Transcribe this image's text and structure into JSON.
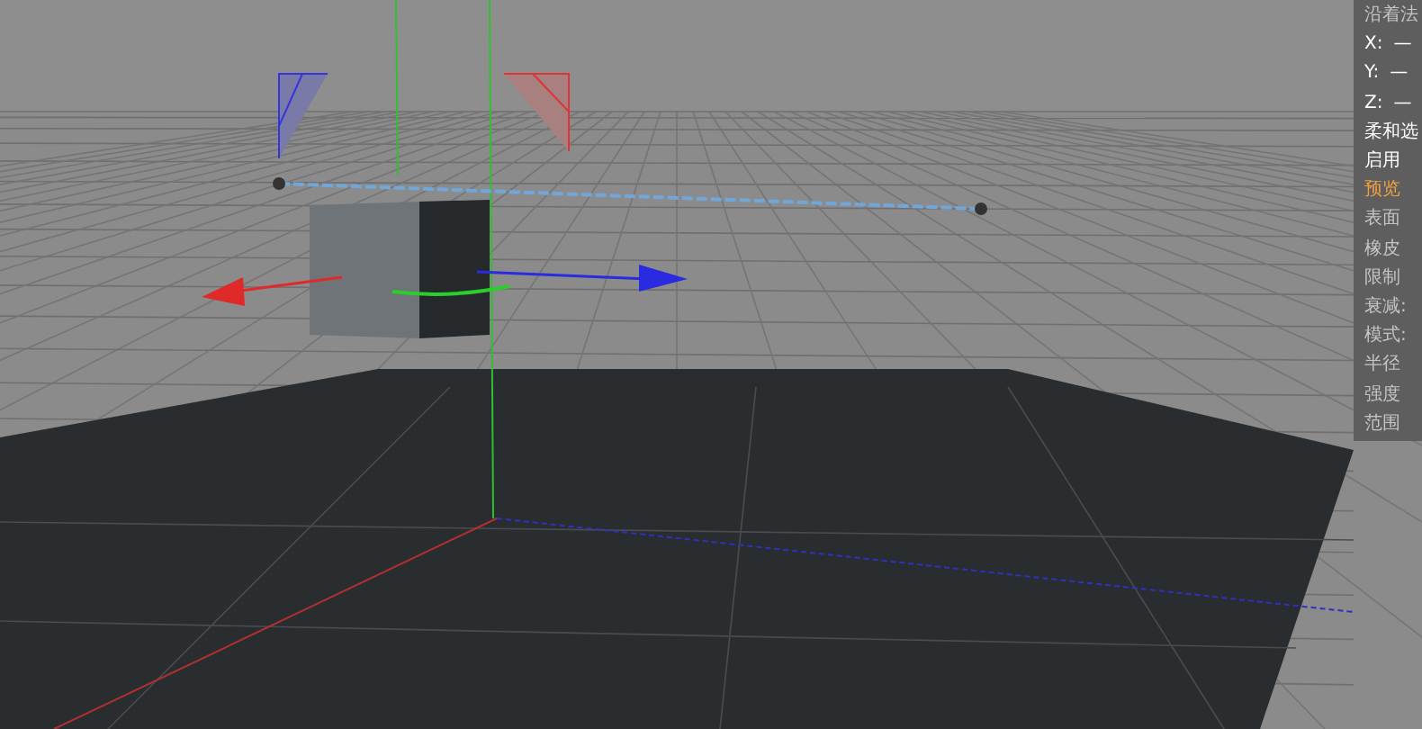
{
  "attribute_panel": {
    "items": [
      {
        "kind": "label",
        "text": "沿着法",
        "disabled": true,
        "highlighted": false
      },
      {
        "kind": "coord",
        "text": "X:",
        "value": "—",
        "disabled": false,
        "highlighted": false
      },
      {
        "kind": "coord",
        "text": "Y:",
        "value": "—",
        "disabled": false,
        "highlighted": false
      },
      {
        "kind": "coord",
        "text": "Z:",
        "value": "—",
        "disabled": false,
        "highlighted": false
      },
      {
        "kind": "label",
        "text": "柔和选",
        "disabled": false,
        "highlighted": false
      },
      {
        "kind": "label",
        "text": "启用",
        "disabled": false,
        "highlighted": false
      },
      {
        "kind": "label",
        "text": "预览",
        "disabled": false,
        "highlighted": true
      },
      {
        "kind": "label",
        "text": "表面",
        "disabled": true,
        "highlighted": false
      },
      {
        "kind": "label",
        "text": "橡皮",
        "disabled": true,
        "highlighted": false
      },
      {
        "kind": "label",
        "text": "限制",
        "disabled": true,
        "highlighted": false
      },
      {
        "kind": "label",
        "text": "衰减:",
        "disabled": true,
        "highlighted": false
      },
      {
        "kind": "label",
        "text": "模式:",
        "disabled": true,
        "highlighted": false
      },
      {
        "kind": "label",
        "text": "半径",
        "disabled": true,
        "highlighted": false
      },
      {
        "kind": "label",
        "text": "强度",
        "disabled": true,
        "highlighted": false
      },
      {
        "kind": "label",
        "text": "范围",
        "disabled": true,
        "highlighted": false
      }
    ]
  }
}
